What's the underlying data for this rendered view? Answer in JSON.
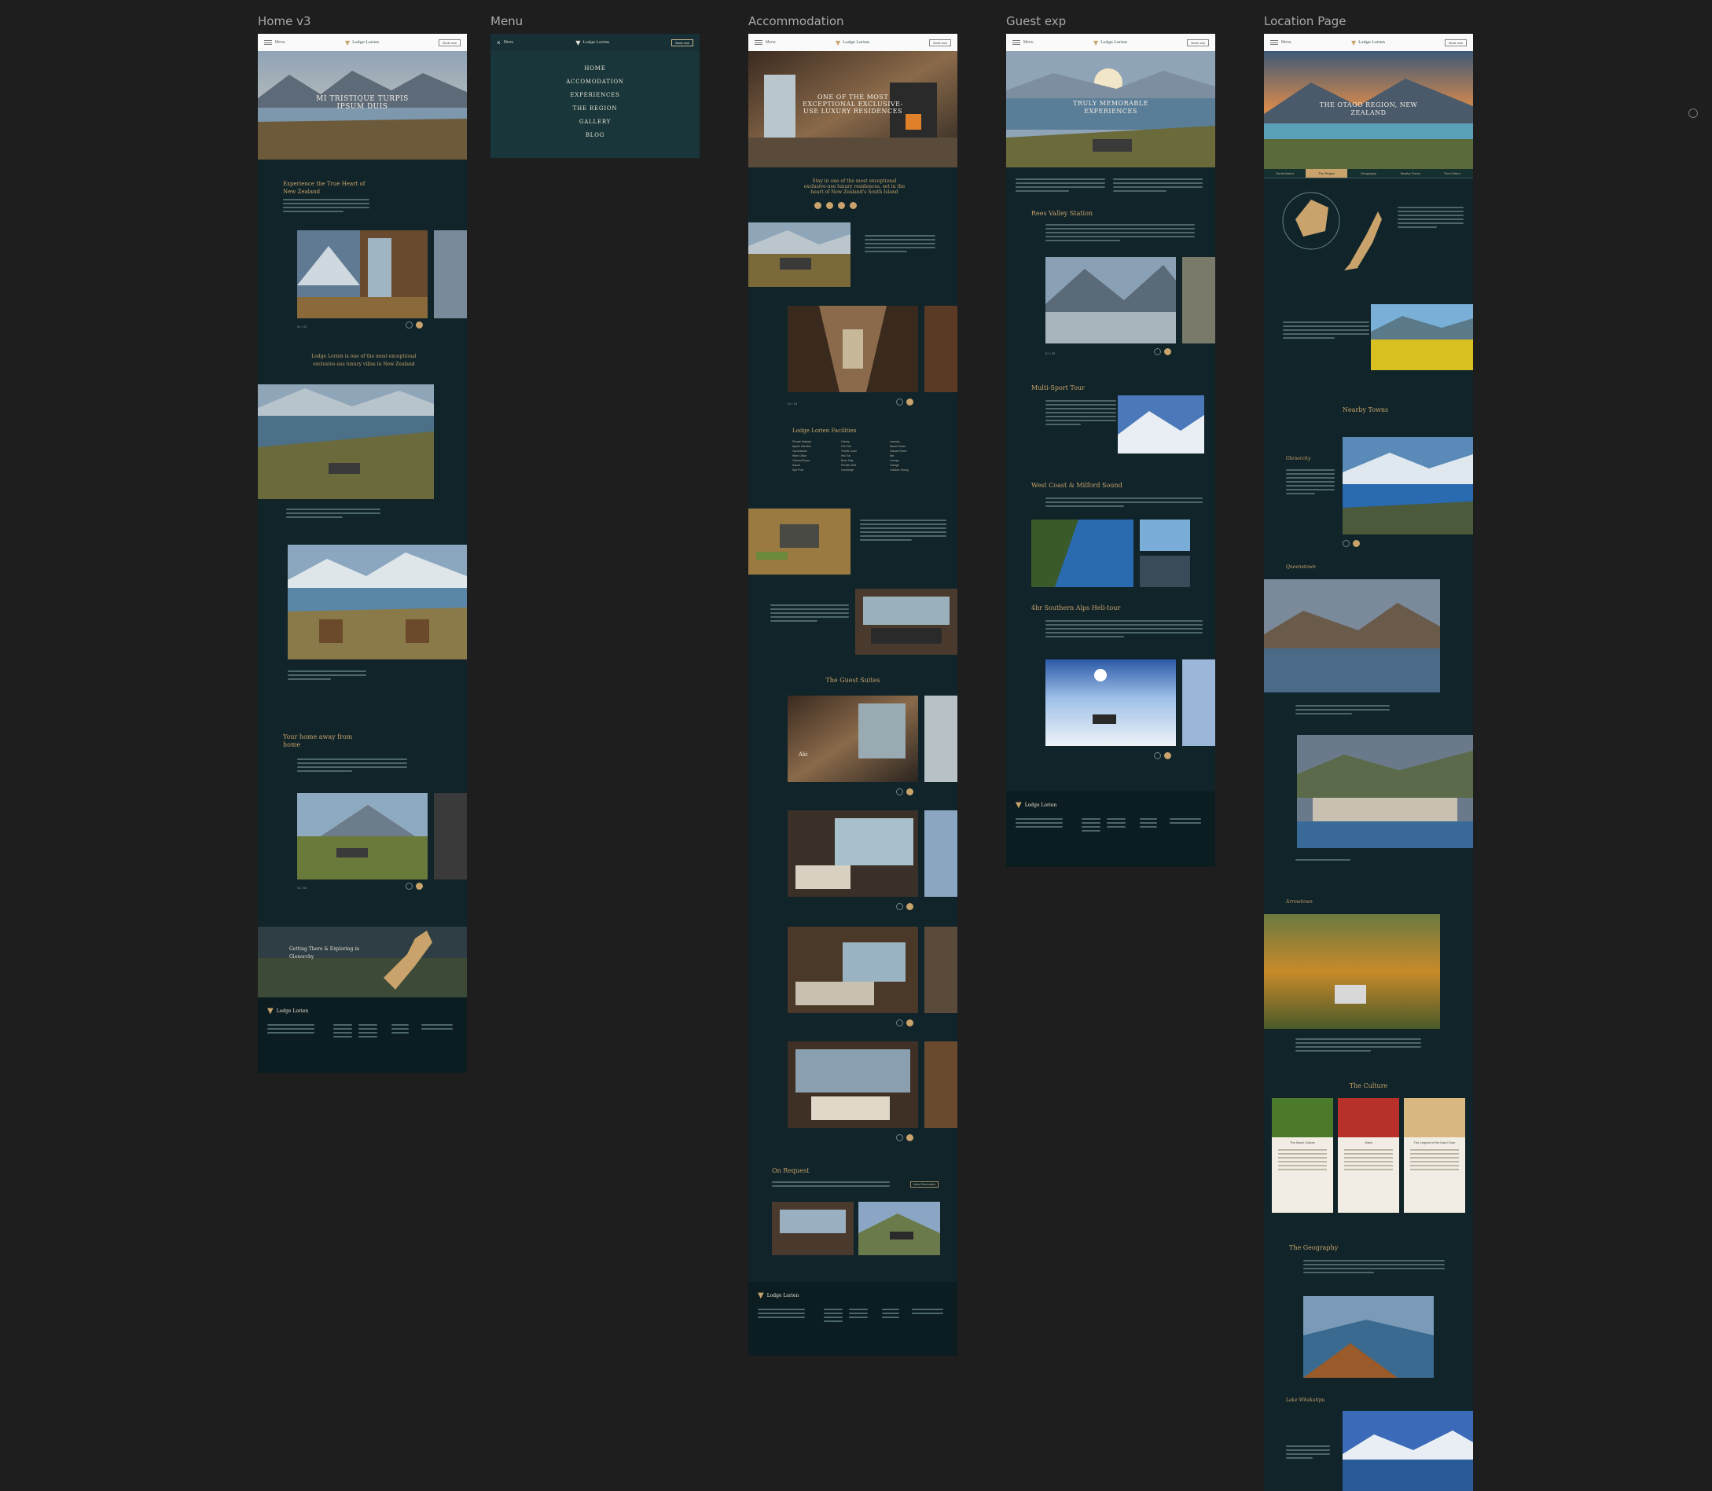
{
  "frames": {
    "home": {
      "label": "Home v3"
    },
    "menu": {
      "label": "Menu"
    },
    "accommodation": {
      "label": "Accommodation"
    },
    "guest": {
      "label": "Guest exp"
    },
    "location": {
      "label": "Location Page"
    }
  },
  "common": {
    "logo_text": "Lodge Lorien",
    "menu_label": "Menu",
    "book_label": "Book now"
  },
  "home": {
    "hero_title": "MI TRISTIQUE TURPIS IPSUM DUIS",
    "h_experience": "Experience the True Heart of New Zealand",
    "h_lodge": "Lodge Lorien is one of the most exceptional exclusive-use luxury villas in New Zealand",
    "h_home": "Your home away from home",
    "pager1": "01 / 03",
    "pager2": "01 / 03",
    "banner_text": "Getting There & Exploring in Glenorchy"
  },
  "menu": {
    "items": [
      "HOME",
      "ACCOMODATION",
      "EXPERIENCES",
      "THE REGION",
      "GALLERY",
      "BLOG"
    ]
  },
  "accommodation": {
    "hero_title": "ONE OF THE MOST EXCEPTIONAL EXCLUSIVE-USE LUXURY RESIDENCES",
    "intro": "Stay in one of the most exceptional exclusive-use luxury residences, set in the heart of New Zealand's South Island",
    "facilities": "Lodge Lorien Facilities",
    "suites": "The Guest Suites",
    "request": "On Request",
    "suite_names": [
      "Aki",
      "",
      "",
      ""
    ],
    "pager": "01 / 03",
    "request_btn": "Make Reservation",
    "facility_items": [
      "Private Helipad",
      "Alpine Gardens",
      "Gymnasium",
      "Wine Cellar",
      "Cinema Room",
      "Sauna",
      "Spa Pool",
      "Library",
      "Fire Pits",
      "Tennis Court",
      "Hot Tub",
      "Boat Jetty",
      "Private Chef",
      "Concierge",
      "Laundry",
      "Steam Room",
      "Games Room",
      "Bar",
      "Lounge",
      "Garage",
      "Outdoor Dining"
    ]
  },
  "guest": {
    "hero_title": "TRULY MEMORABLE EXPERIENCES",
    "h1": "Rees Valley Station",
    "h2": "Multi-Sport Tour",
    "h3": "West Coast & Milford Sound",
    "h4": "4hr Southern Alps Heli-tour",
    "pager": "01 / 03"
  },
  "location": {
    "hero_title": "THE OTAGO REGION, NEW ZEALAND",
    "tabs": [
      "South Island",
      "The Region",
      "Geography",
      "Nearby Towns",
      "The Culture"
    ],
    "nearby": "Nearby Towns",
    "glenorchy": "Glenorchy",
    "queenstown": "Queenstown",
    "arrowtown": "Arrowtown",
    "culture": "The Culture",
    "culture_cards": [
      "The Maori Culture",
      "Haka",
      "The Legend of the Kauri Gum"
    ],
    "geography": "The Geography",
    "lake": "Lake Whakatipu"
  },
  "colors": {
    "page_bg": "#1e1e1e",
    "frame_bg": "#10242a",
    "accent": "#c9a36b"
  }
}
